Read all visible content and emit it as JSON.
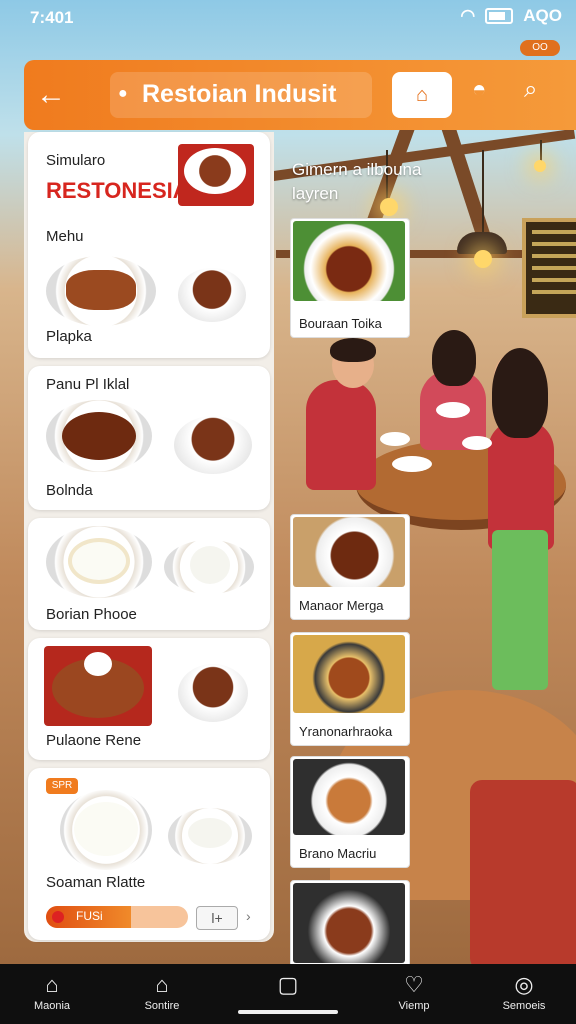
{
  "status_bar": {
    "time": "7:401",
    "right_text": "AQO",
    "pill": "OO"
  },
  "header": {
    "title": "Restoian Indusit"
  },
  "list": {
    "top_card": {
      "label1": "Simularo",
      "brand": "RESTONESIA",
      "section": "Mehu",
      "item": "Plapka"
    },
    "cards": [
      {
        "heading": "Panu Pl Iklal",
        "label": "Bolnda"
      },
      {
        "label": "Borian Phooe"
      },
      {
        "label": "Pulaone Rene"
      },
      {
        "badge": "SPR",
        "label": "Soaman Rlatte",
        "progress_label": "FUSi",
        "progress": 0.6,
        "stepper": "l+"
      }
    ]
  },
  "right_panel": {
    "header_line1": "Gimern a ilbouna",
    "header_line2": "layren",
    "cards": [
      {
        "label": "Bouraan Toika"
      },
      {
        "label": "Manaor Merga"
      },
      {
        "label": "Yranonarhraoka"
      },
      {
        "label": "Brano Macriu"
      }
    ]
  },
  "nav": [
    {
      "label": "Maonia",
      "icon": "home-icon"
    },
    {
      "label": "Sontire",
      "icon": "store-icon"
    },
    {
      "label": "",
      "icon": "square-icon"
    },
    {
      "label": "Viemp",
      "icon": "heart-icon"
    },
    {
      "label": "Semoeis",
      "icon": "profile-icon"
    }
  ]
}
